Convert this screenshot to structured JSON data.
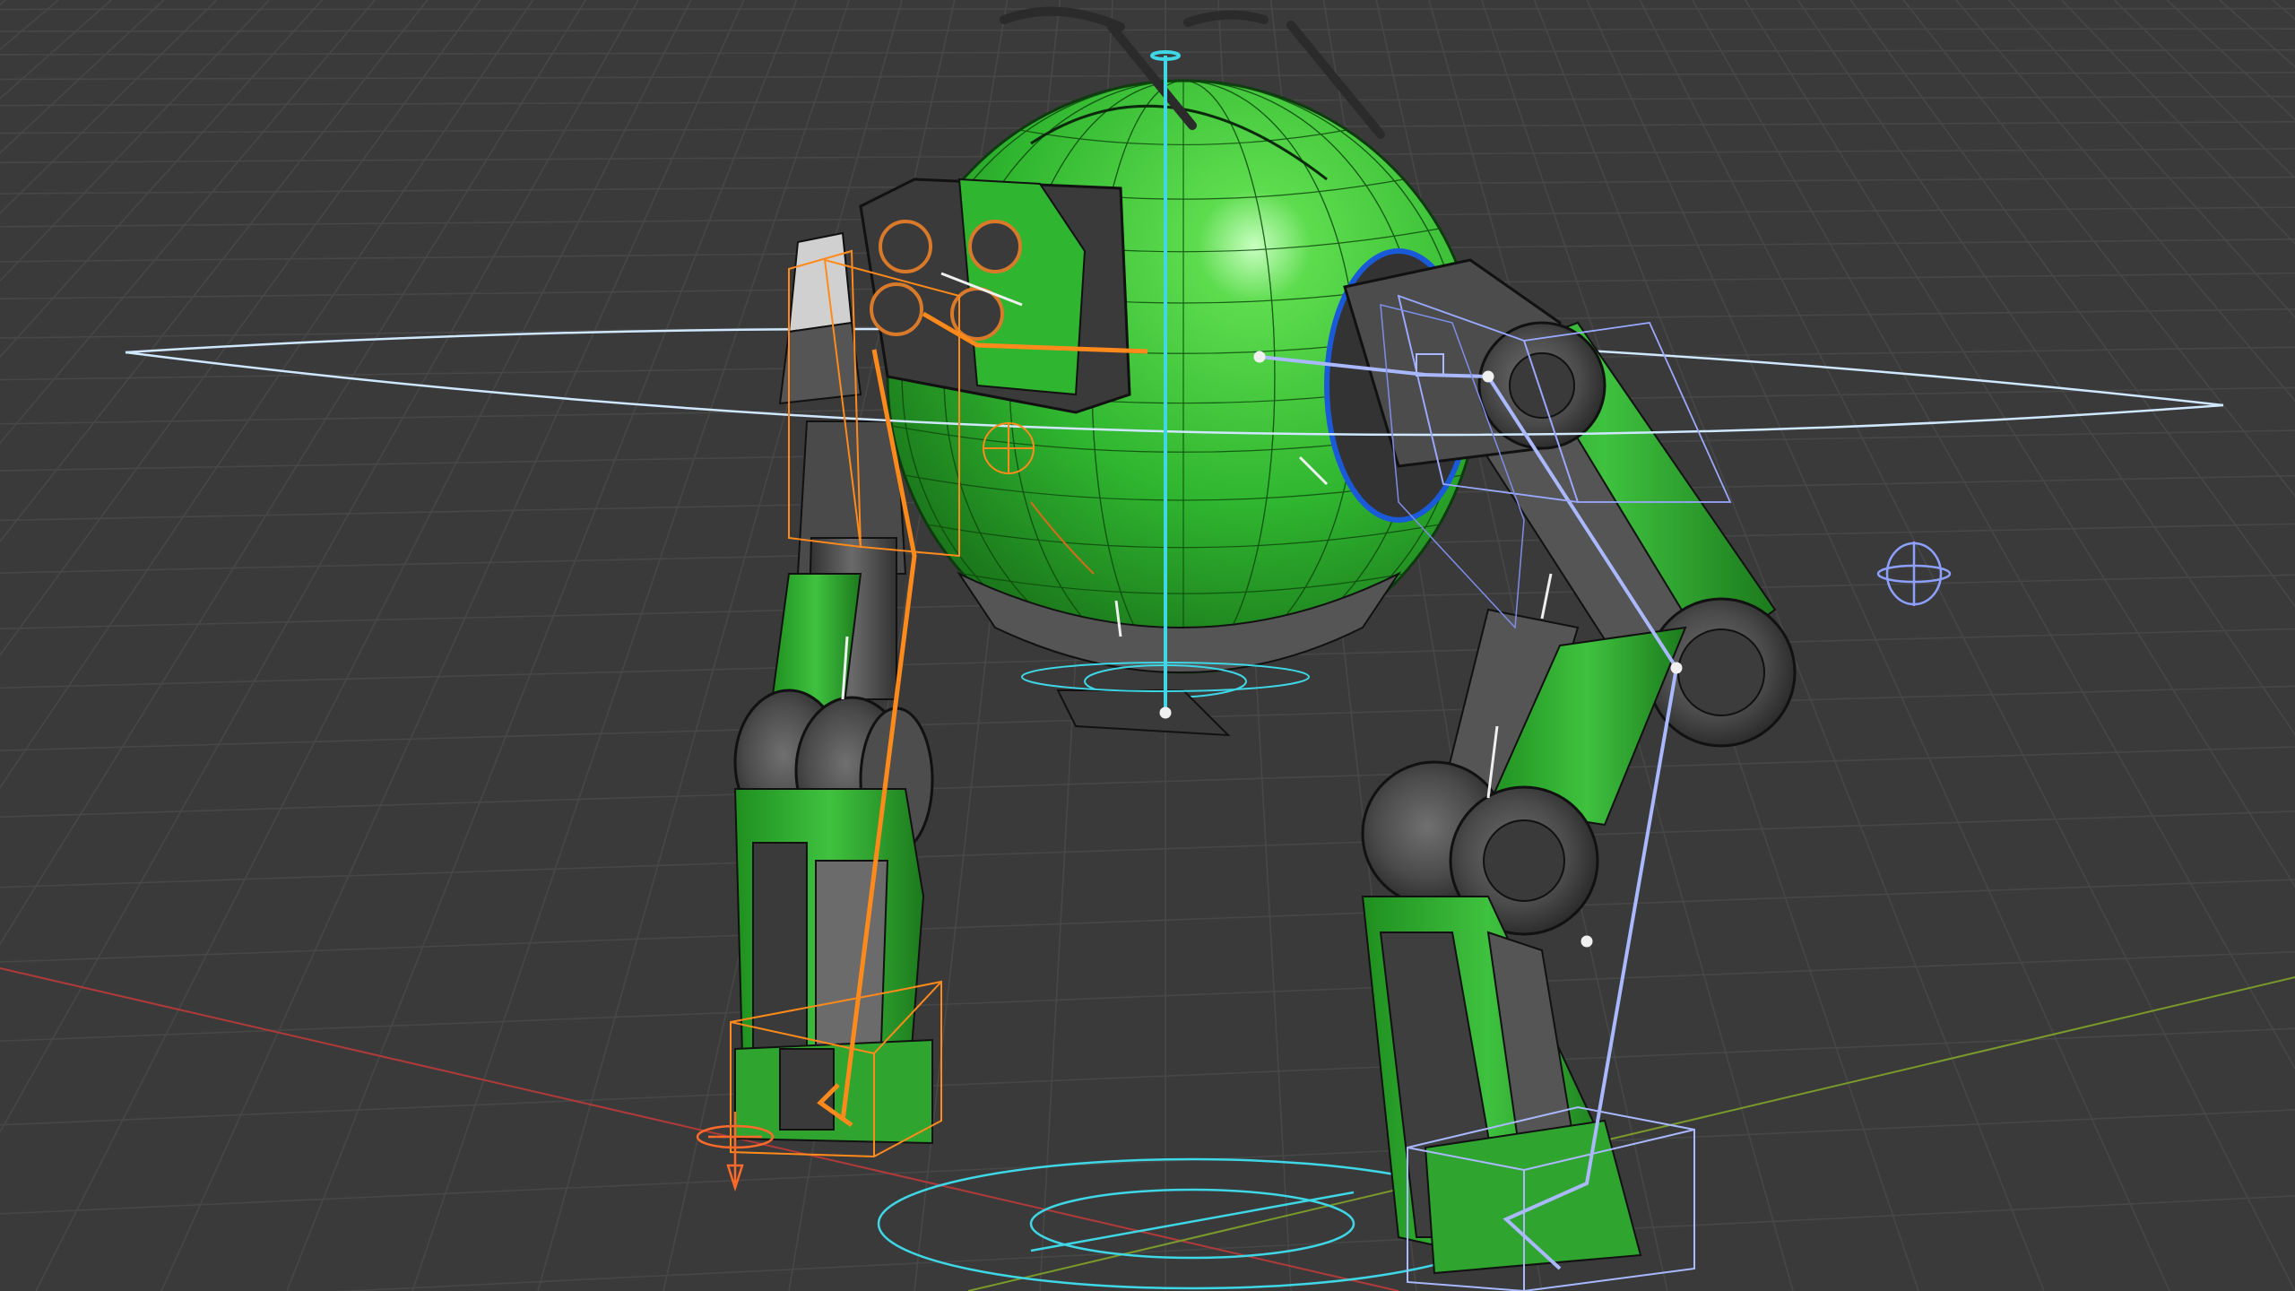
{
  "scene": {
    "view": "3d-viewport-perspective",
    "mesh_color": "#2fb52f",
    "mesh_dark": "#1d7a1d",
    "metal_color": "#4a4a4a",
    "background_color": "#3a3a3a",
    "grid_color": "#454545",
    "x_axis_color": "#b03a3a",
    "y_axis_color": "#7a9a2a",
    "rig_orange": "#ff8a1c",
    "rig_blue": "#a9b8ff",
    "rig_cyan": "#3fd7e6",
    "icons": [
      "rig-root-circle-icon",
      "ik-target-icon",
      "pole-target-icon",
      "foot-control-icon"
    ]
  }
}
